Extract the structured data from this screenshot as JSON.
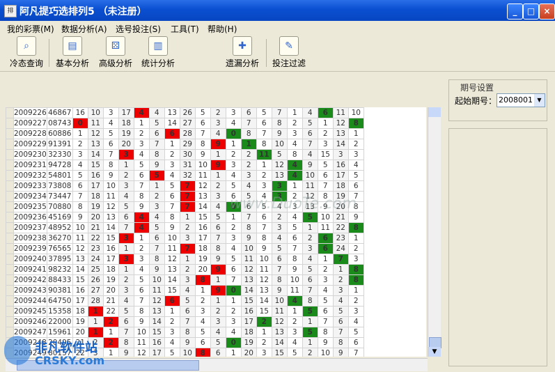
{
  "window": {
    "title": "阿凡提巧选排列5 （未注册）",
    "icon": "app-icon",
    "controls": [
      "_",
      "□",
      "×"
    ]
  },
  "menu": [
    "我的彩票(M)",
    "数据分析(A)",
    "选号投注(S)",
    "工具(T)",
    "帮助(H)"
  ],
  "toolbar": [
    {
      "label": "冷态查询",
      "icon": "magnifier-icon"
    },
    {
      "label": "基本分析",
      "icon": "notebook-icon"
    },
    {
      "label": "高级分析",
      "icon": "dice-icon"
    },
    {
      "label": "统计分析",
      "icon": "bar-chart-icon"
    },
    {
      "label": "遗漏分析",
      "icon": "puzzle-icon"
    },
    {
      "label": "投注过滤",
      "icon": "filter-icon"
    }
  ],
  "settings": {
    "group_label": "期号设置",
    "start_label": "起始期号：",
    "start_value": "2008001"
  },
  "logo": {
    "name": "非凡软件站",
    "domain": "CRSKY.com"
  },
  "watermark": "www.DuoTe.com",
  "colors": {
    "hit_red": "#e00000",
    "hit_green": "#1a8a1a"
  },
  "rows": [
    {
      "p": "2009226",
      "n": "46867",
      "c": [
        "16",
        "10",
        "3",
        "17",
        "4",
        "4",
        "13",
        "26",
        "5",
        "2",
        "3",
        "6",
        "5",
        "7",
        "1",
        "4",
        "6",
        "11",
        "10"
      ],
      "h": {
        "4": "r",
        "16": "g"
      }
    },
    {
      "p": "2009227",
      "n": "08743",
      "c": [
        "0",
        "11",
        "4",
        "18",
        "1",
        "5",
        "14",
        "27",
        "6",
        "3",
        "4",
        "7",
        "6",
        "8",
        "2",
        "5",
        "1",
        "12",
        "8"
      ],
      "h": {
        "0": "r",
        "18": "g"
      }
    },
    {
      "p": "2009228",
      "n": "60886",
      "c": [
        "1",
        "12",
        "5",
        "19",
        "2",
        "6",
        "6",
        "28",
        "7",
        "4",
        "0",
        "8",
        "7",
        "9",
        "3",
        "6",
        "2",
        "13",
        "1"
      ],
      "h": {
        "6": "r",
        "10": "g"
      }
    },
    {
      "p": "2009229",
      "n": "91391",
      "c": [
        "2",
        "13",
        "6",
        "20",
        "3",
        "7",
        "1",
        "29",
        "8",
        "9",
        "1",
        "1",
        "8",
        "10",
        "4",
        "7",
        "3",
        "14",
        "2"
      ],
      "h": {
        "9": "r",
        "11": "g"
      }
    },
    {
      "p": "2009230",
      "n": "32330",
      "c": [
        "3",
        "14",
        "7",
        "3",
        "4",
        "8",
        "2",
        "30",
        "9",
        "1",
        "2",
        "2",
        "11",
        "5",
        "8",
        "4",
        "15",
        "3",
        "3"
      ],
      "h": {
        "3": "r",
        "12": "g"
      }
    },
    {
      "p": "2009231",
      "n": "94728",
      "c": [
        "4",
        "15",
        "8",
        "1",
        "5",
        "9",
        "3",
        "31",
        "10",
        "9",
        "3",
        "2",
        "1",
        "12",
        "4",
        "9",
        "5",
        "16",
        "4"
      ],
      "h": {
        "9": "r",
        "14": "g"
      }
    },
    {
      "p": "2009232",
      "n": "54801",
      "c": [
        "5",
        "16",
        "9",
        "2",
        "6",
        "5",
        "4",
        "32",
        "11",
        "1",
        "4",
        "3",
        "2",
        "13",
        "4",
        "10",
        "6",
        "17",
        "5"
      ],
      "h": {
        "5": "r",
        "14": "g"
      }
    },
    {
      "p": "2009233",
      "n": "73808",
      "c": [
        "6",
        "17",
        "10",
        "3",
        "7",
        "1",
        "5",
        "7",
        "12",
        "2",
        "5",
        "4",
        "3",
        "3",
        "1",
        "11",
        "7",
        "18",
        "6"
      ],
      "h": {
        "7": "r",
        "13": "g"
      }
    },
    {
      "p": "2009234",
      "n": "73447",
      "c": [
        "7",
        "18",
        "11",
        "4",
        "8",
        "2",
        "6",
        "7",
        "13",
        "3",
        "6",
        "5",
        "4",
        "3",
        "2",
        "12",
        "8",
        "19",
        "7"
      ],
      "h": {
        "7": "r",
        "13": "g"
      }
    },
    {
      "p": "2009235",
      "n": "70880",
      "c": [
        "8",
        "19",
        "12",
        "5",
        "9",
        "3",
        "7",
        "7",
        "14",
        "4",
        "0",
        "6",
        "5",
        "4",
        "3",
        "13",
        "9",
        "20",
        "8"
      ],
      "h": {
        "7": "r",
        "10": "g"
      }
    },
    {
      "p": "2009236",
      "n": "45169",
      "c": [
        "9",
        "20",
        "13",
        "6",
        "4",
        "4",
        "8",
        "1",
        "15",
        "5",
        "1",
        "7",
        "6",
        "2",
        "4",
        "5",
        "10",
        "21",
        "9"
      ],
      "h": {
        "4": "r",
        "15": "g"
      }
    },
    {
      "p": "2009237",
      "n": "48952",
      "c": [
        "10",
        "21",
        "14",
        "7",
        "4",
        "5",
        "9",
        "2",
        "16",
        "6",
        "2",
        "8",
        "7",
        "3",
        "5",
        "1",
        "11",
        "22",
        "8"
      ],
      "h": {
        "4": "r",
        "18": "g"
      }
    },
    {
      "p": "2009238",
      "n": "36270",
      "c": [
        "11",
        "22",
        "15",
        "3",
        "1",
        "6",
        "10",
        "3",
        "17",
        "7",
        "3",
        "9",
        "8",
        "4",
        "6",
        "2",
        "6",
        "23",
        "1"
      ],
      "h": {
        "3": "r",
        "16": "g"
      }
    },
    {
      "p": "2009239",
      "n": "76565",
      "c": [
        "12",
        "23",
        "16",
        "1",
        "2",
        "7",
        "11",
        "7",
        "18",
        "8",
        "4",
        "10",
        "9",
        "5",
        "7",
        "3",
        "6",
        "24",
        "2"
      ],
      "h": {
        "7": "r",
        "16": "g"
      }
    },
    {
      "p": "2009240",
      "n": "37895",
      "c": [
        "13",
        "24",
        "17",
        "3",
        "3",
        "8",
        "12",
        "1",
        "19",
        "9",
        "5",
        "11",
        "10",
        "6",
        "8",
        "4",
        "1",
        "7",
        "3"
      ],
      "h": {
        "3": "r",
        "17": "g"
      }
    },
    {
      "p": "2009241",
      "n": "98232",
      "c": [
        "14",
        "25",
        "18",
        "1",
        "4",
        "9",
        "13",
        "2",
        "20",
        "9",
        "6",
        "12",
        "11",
        "7",
        "9",
        "5",
        "2",
        "1",
        "8"
      ],
      "h": {
        "9": "r",
        "18": "g"
      }
    },
    {
      "p": "2009242",
      "n": "88433",
      "c": [
        "15",
        "26",
        "19",
        "2",
        "5",
        "10",
        "14",
        "3",
        "8",
        "1",
        "7",
        "13",
        "12",
        "8",
        "10",
        "6",
        "3",
        "2",
        "8"
      ],
      "h": {
        "8": "r",
        "18": "g"
      }
    },
    {
      "p": "2009243",
      "n": "90381",
      "c": [
        "16",
        "27",
        "20",
        "3",
        "6",
        "11",
        "15",
        "4",
        "1",
        "9",
        "0",
        "14",
        "13",
        "9",
        "11",
        "7",
        "4",
        "3",
        "1"
      ],
      "h": {
        "9": "r",
        "10": "g"
      }
    },
    {
      "p": "2009244",
      "n": "64750",
      "c": [
        "17",
        "28",
        "21",
        "4",
        "7",
        "12",
        "6",
        "5",
        "2",
        "1",
        "1",
        "15",
        "14",
        "10",
        "4",
        "8",
        "5",
        "4",
        "2"
      ],
      "h": {
        "6": "r",
        "14": "g"
      }
    },
    {
      "p": "2009245",
      "n": "15358",
      "c": [
        "18",
        "1",
        "22",
        "5",
        "8",
        "13",
        "1",
        "6",
        "3",
        "2",
        "2",
        "16",
        "15",
        "11",
        "1",
        "5",
        "6",
        "5",
        "3"
      ],
      "h": {
        "1": "r",
        "15": "g"
      }
    },
    {
      "p": "2009246",
      "n": "22000",
      "c": [
        "19",
        "1",
        "2",
        "6",
        "9",
        "14",
        "2",
        "7",
        "4",
        "3",
        "3",
        "17",
        "2",
        "12",
        "2",
        "1",
        "7",
        "6",
        "4"
      ],
      "h": {
        "2": "r",
        "12": "g"
      }
    },
    {
      "p": "2009247",
      "n": "15961",
      "c": [
        "20",
        "1",
        "1",
        "7",
        "10",
        "15",
        "3",
        "8",
        "5",
        "4",
        "4",
        "18",
        "1",
        "13",
        "3",
        "5",
        "8",
        "7",
        "5"
      ],
      "h": {
        "1": "r",
        "15": "g"
      }
    },
    {
      "p": "2009248",
      "n": "20495",
      "c": [
        "21",
        "2",
        "2",
        "8",
        "11",
        "16",
        "4",
        "9",
        "6",
        "5",
        "0",
        "19",
        "2",
        "14",
        "4",
        "1",
        "9",
        "8",
        "6"
      ],
      "h": {
        "2": "r",
        "10": "g"
      }
    },
    {
      "p": "2009249",
      "n": "80157",
      "c": [
        "22",
        "3",
        "1",
        "9",
        "12",
        "17",
        "5",
        "10",
        "8",
        "6",
        "1",
        "20",
        "3",
        "15",
        "5",
        "2",
        "10",
        "9",
        "7"
      ],
      "h": {
        "8": "r"
      }
    }
  ]
}
